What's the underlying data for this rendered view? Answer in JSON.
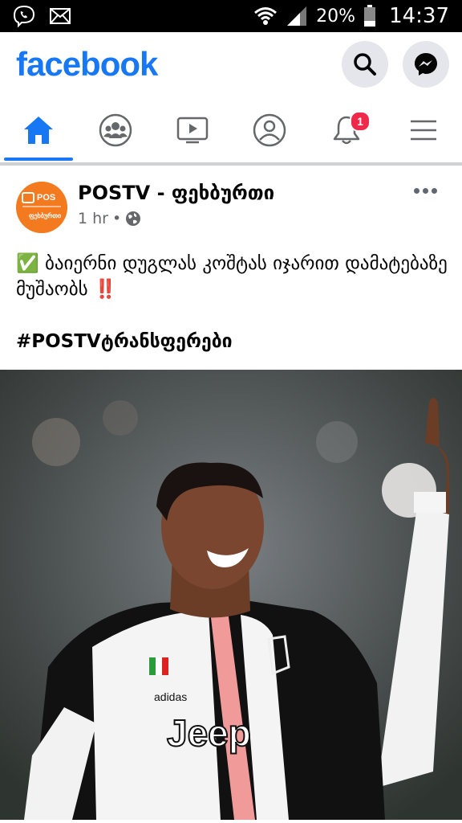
{
  "status_bar": {
    "battery": "20%",
    "time": "14:37",
    "icons": [
      "viber-icon",
      "mail-icon",
      "wifi-icon",
      "signal-icon",
      "battery-icon"
    ]
  },
  "header": {
    "logo": "facebook",
    "buttons": [
      "search-icon",
      "messenger-icon"
    ]
  },
  "tabs": {
    "items": [
      "home",
      "groups",
      "watch",
      "profile",
      "notifications",
      "menu"
    ],
    "active": "home",
    "notifications_badge": "1"
  },
  "post": {
    "author": "POSTV - ფეხბურთი",
    "avatar_text": "POS",
    "avatar_subtext": "ფეხბურთი",
    "time": "1 hr",
    "separator": "•",
    "privacy_icon": "globe-icon",
    "text_check": "✅",
    "text": "ბაიერნი დუგლას კოშტას იჯარით დამატებაზე მუშაობს",
    "text_emphasis": "‼️",
    "hashtag": "#POSTVტრანსფერები",
    "image_text": {
      "sponsor": "Jeep",
      "kit_brand": "adidas"
    }
  },
  "colors": {
    "brand": "#1877f2",
    "badge": "#f02849",
    "icon_grey": "#65676b"
  }
}
